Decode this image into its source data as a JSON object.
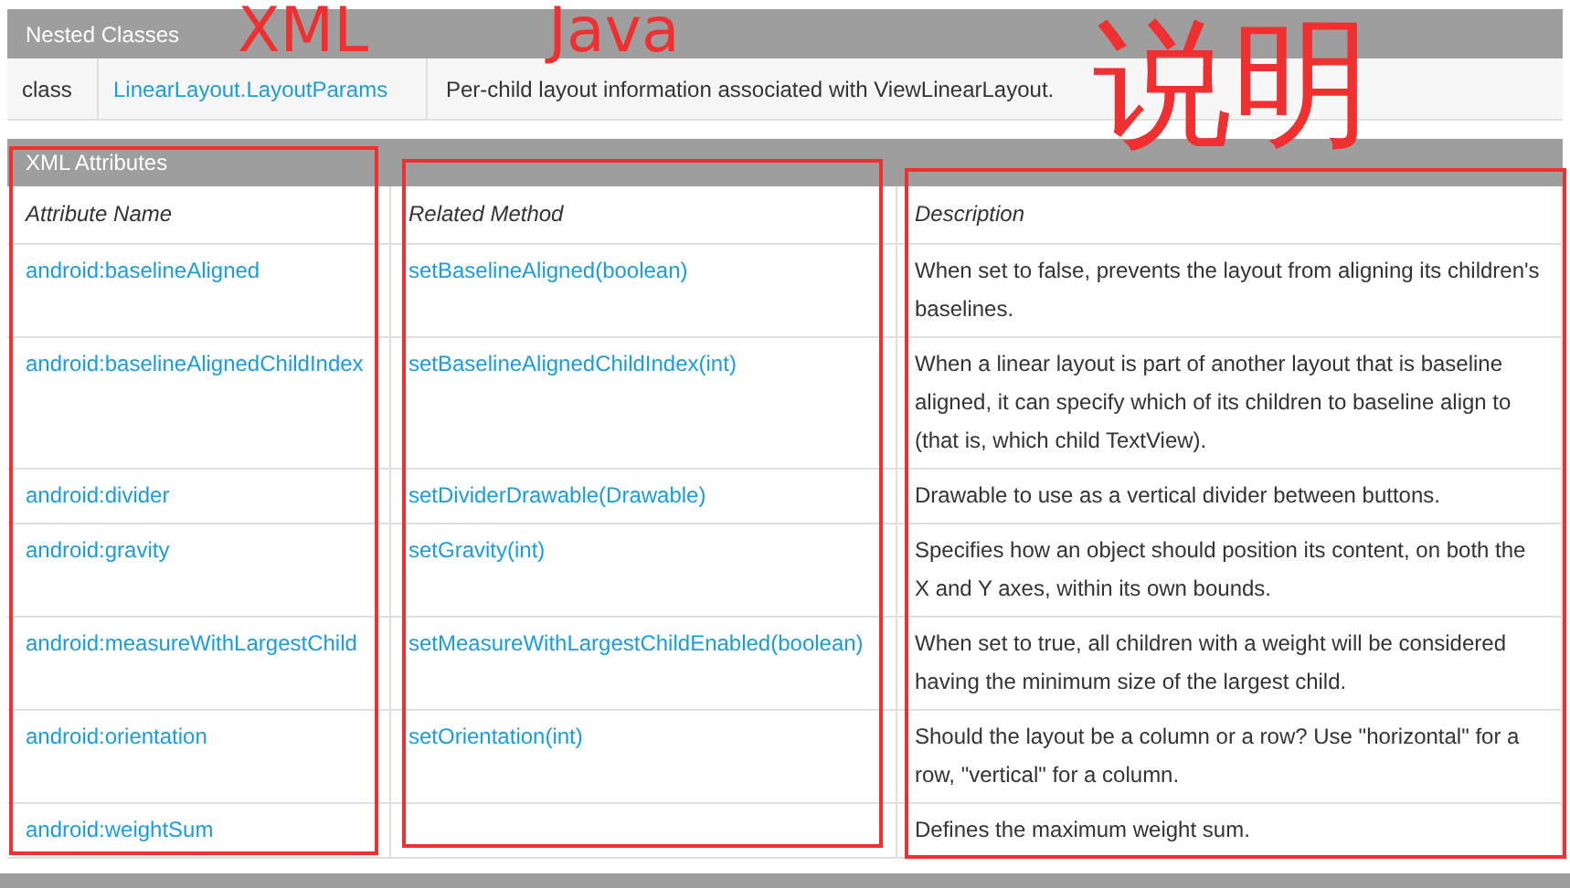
{
  "nested_classes": {
    "title": "Nested Classes",
    "rows": [
      {
        "type": "class",
        "name": "LinearLayout.LayoutParams",
        "description": "Per-child layout information associated with ViewLinearLayout."
      }
    ]
  },
  "xml_attributes": {
    "title": "XML Attributes",
    "columns": [
      "Attribute Name",
      "Related Method",
      "Description"
    ],
    "rows": [
      {
        "attribute": "android:baselineAligned",
        "method": "setBaselineAligned(boolean)",
        "description": "When set to false, prevents the layout from aligning its children's baselines."
      },
      {
        "attribute": "android:baselineAlignedChildIndex",
        "method": "setBaselineAlignedChildIndex(int)",
        "description": "When a linear layout is part of another layout that is baseline aligned, it can specify which of its children to baseline align to (that is, which child TextView)."
      },
      {
        "attribute": "android:divider",
        "method": "setDividerDrawable(Drawable)",
        "description": "Drawable to use as a vertical divider between buttons."
      },
      {
        "attribute": "android:gravity",
        "method": "setGravity(int)",
        "description": "Specifies how an object should position its content, on both the X and Y axes, within its own bounds."
      },
      {
        "attribute": "android:measureWithLargestChild",
        "method": "setMeasureWithLargestChildEnabled(boolean)",
        "description": "When set to true, all children with a weight will be considered having the minimum size of the largest child."
      },
      {
        "attribute": "android:orientation",
        "method": "setOrientation(int)",
        "description": "Should the layout be a column or a row? Use \"horizontal\" for a row, \"vertical\" for a column."
      },
      {
        "attribute": "android:weightSum",
        "description": "Defines the maximum weight sum."
      }
    ]
  },
  "annotations": [
    "XML",
    "Java",
    "说明"
  ]
}
